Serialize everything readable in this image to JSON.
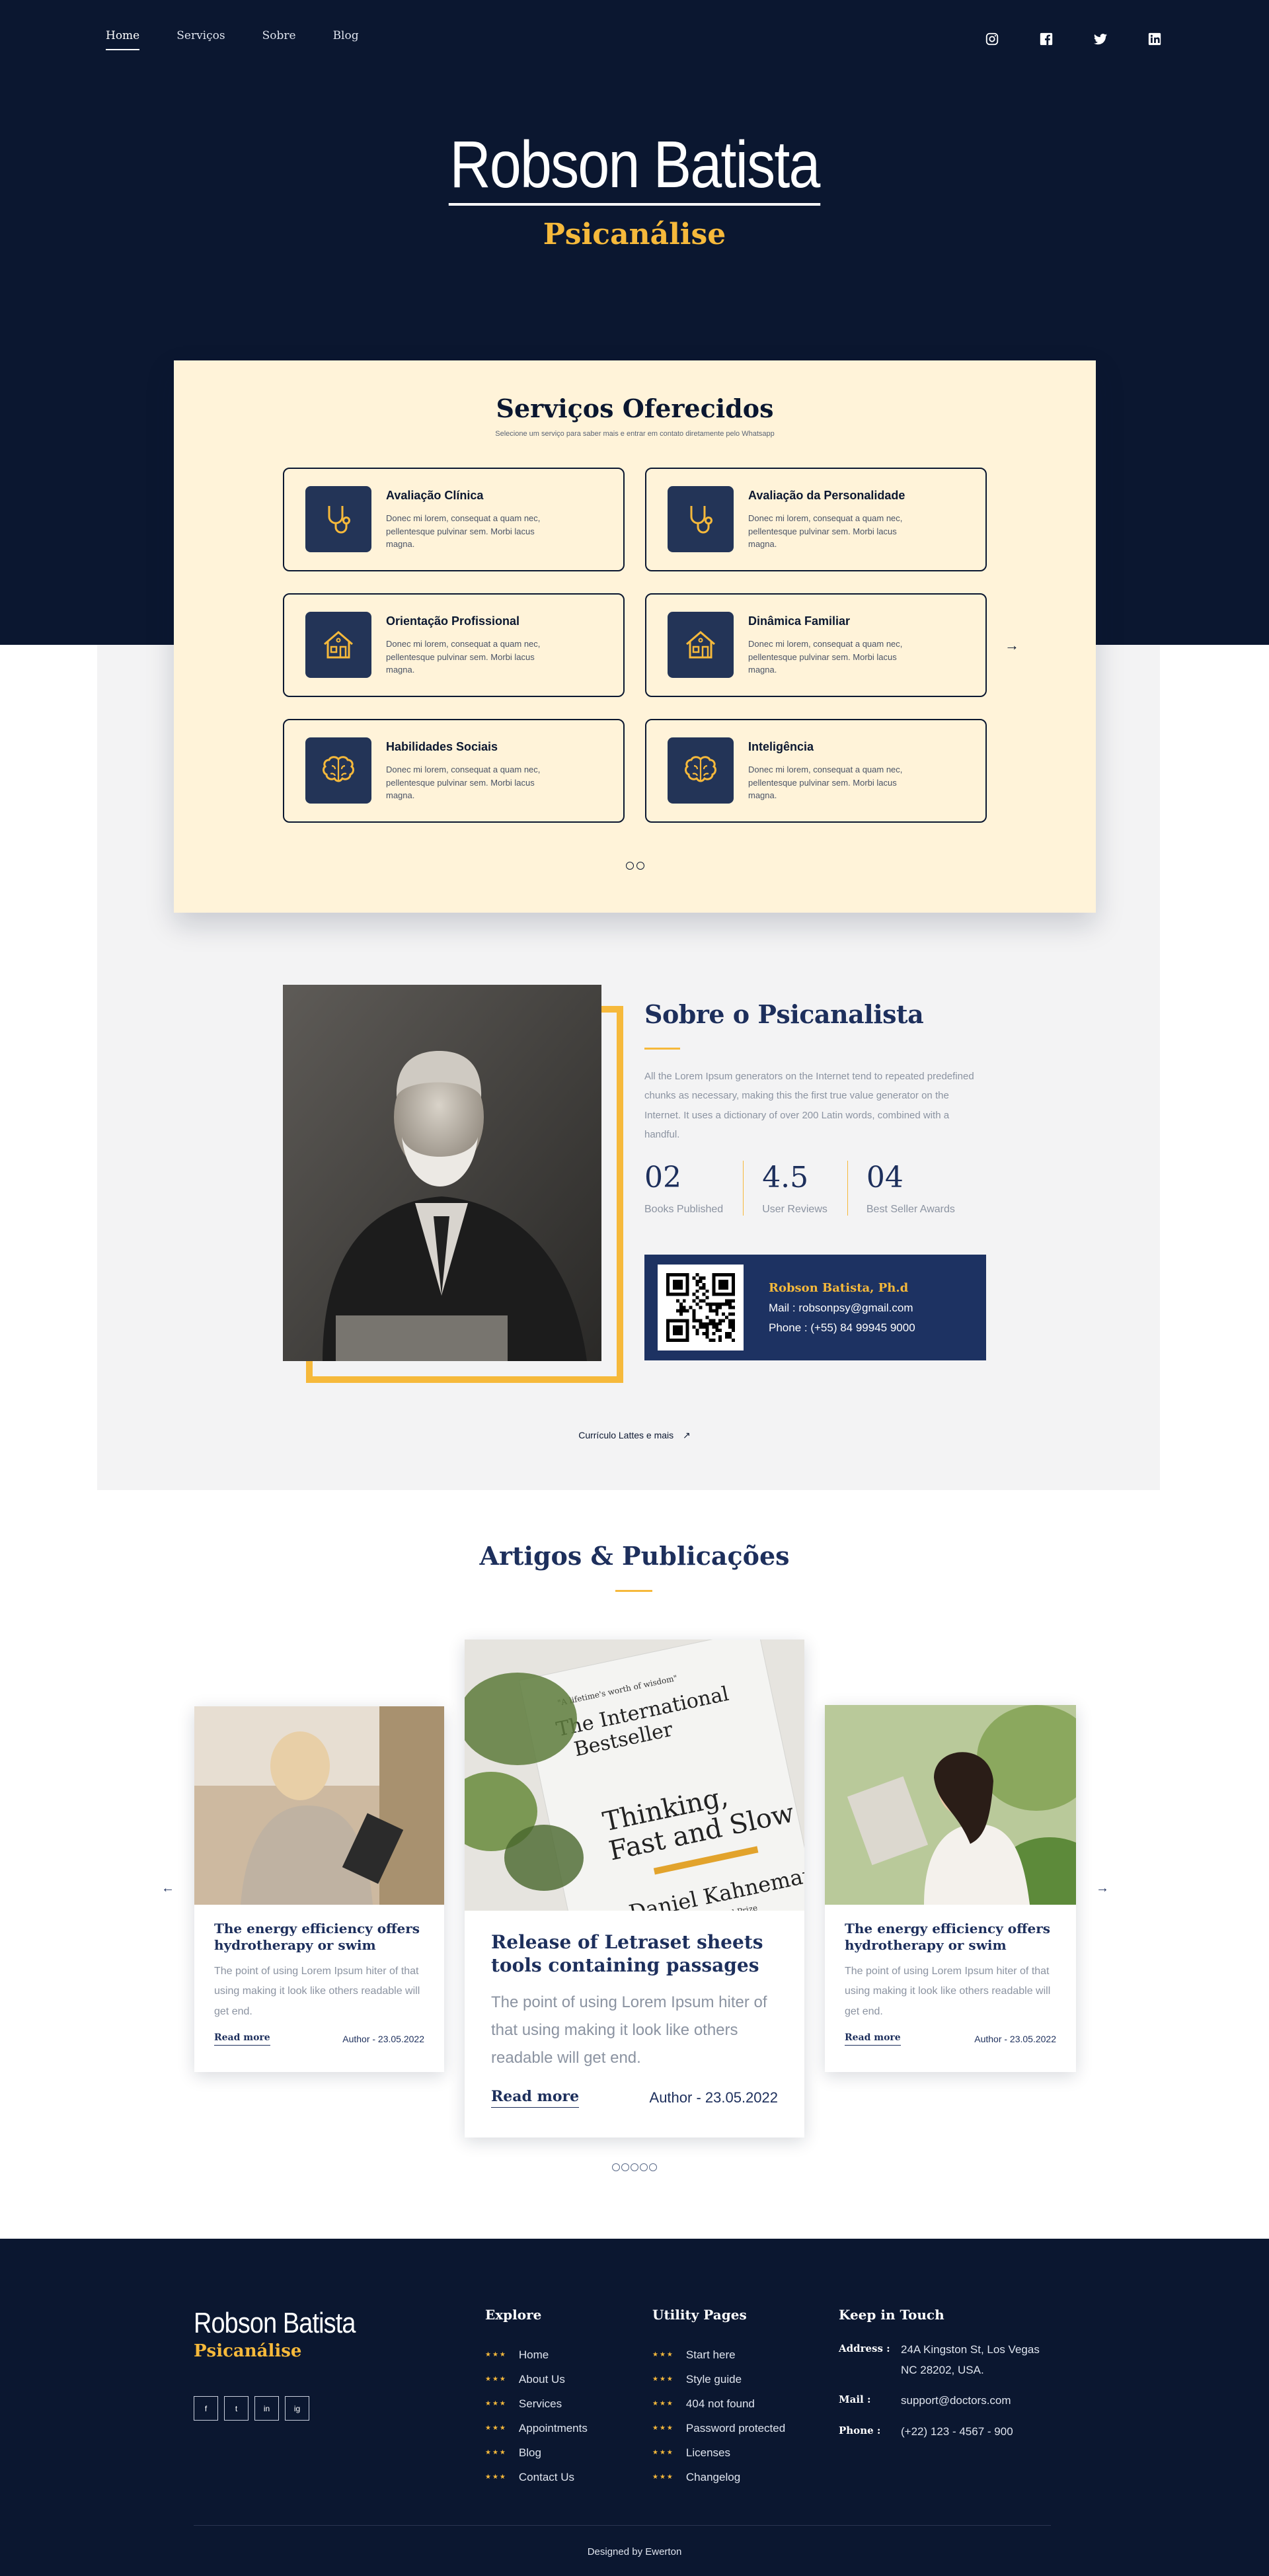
{
  "nav": {
    "items": [
      {
        "label": "Home",
        "active": true
      },
      {
        "label": "Serviços",
        "active": false
      },
      {
        "label": "Sobre",
        "active": false
      },
      {
        "label": "Blog",
        "active": false
      }
    ],
    "socials": [
      "instagram-icon",
      "facebook-icon",
      "twitter-icon",
      "linkedin-icon"
    ]
  },
  "hero": {
    "title": "Robson Batista",
    "subtitle": "Psicanálise"
  },
  "services": {
    "heading": "Serviços Oferecidos",
    "subheading": "Selecione um serviço para saber mais e entrar em contato diretamente pelo Whatsapp",
    "items": [
      {
        "title": "Avaliação Clínica",
        "text": "Donec mi lorem, consequat a quam nec, pellentesque pulvinar sem. Morbi lacus magna.",
        "icon": "stethoscope-icon"
      },
      {
        "title": "Avaliação da Personalidade",
        "text": "Donec mi lorem, consequat a quam nec, pellentesque pulvinar sem. Morbi lacus magna.",
        "icon": "stethoscope-icon"
      },
      {
        "title": "Orientação Profissional",
        "text": "Donec mi lorem, consequat a quam nec, pellentesque pulvinar sem. Morbi lacus magna.",
        "icon": "house-icon"
      },
      {
        "title": "Dinâmica Familiar",
        "text": "Donec mi lorem, consequat a quam nec, pellentesque pulvinar sem. Morbi lacus magna.",
        "icon": "house-icon"
      },
      {
        "title": "Habilidades Sociais",
        "text": "Donec mi lorem, consequat a quam nec, pellentesque pulvinar sem. Morbi lacus magna.",
        "icon": "brain-icon"
      },
      {
        "title": "Inteligência",
        "text": "Donec mi lorem, consequat a quam nec, pellentesque pulvinar sem. Morbi lacus magna.",
        "icon": "brain-icon"
      }
    ]
  },
  "about": {
    "heading": "Sobre o Psicanalista",
    "paragraph": "All the Lorem Ipsum generators on the Internet tend to repeated predefined chunks as necessary, making this the first true value generator on the Internet. It uses a dictionary of over 200 Latin words, combined with a handful.",
    "stats": [
      {
        "value": "02",
        "label": "Books Published"
      },
      {
        "value": "4.5",
        "label": "User Reviews"
      },
      {
        "value": "04",
        "label": "Best Seller Awards"
      }
    ],
    "card": {
      "name": "Robson Batista, Ph.d",
      "mail": "Mail : robsonpsy@gmail.com",
      "phone": "Phone : (+55) 84 99945 9000"
    },
    "link": "Currículo Lattes e mais"
  },
  "articles": {
    "heading": "Artigos & Publicações",
    "items": [
      {
        "title": "The energy efficiency offers hydrotherapy or swim",
        "text": "The point of using Lorem Ipsum hiter of that using making it look like others readable will get end.",
        "more": "Read more",
        "author": "Author - 23.05.2022"
      },
      {
        "title": "Release of Letraset sheets tools containing  passages",
        "text": "The point of using Lorem Ipsum hiter of that using making it look like others readable will get end.",
        "more": "Read more",
        "author": "Author - 23.05.2022",
        "book_lines": [
          "\"A lifetime's worth of wisdom\"",
          "The International",
          "Bestseller",
          "Thinking,",
          "Fast and Slow",
          "Daniel Kahneman",
          "Nobel Prize"
        ]
      },
      {
        "title": "The energy efficiency offers hydrotherapy or swim",
        "text": "The point of using Lorem Ipsum hiter of that using making it look like others readable will get end.",
        "more": "Read more",
        "author": "Author - 23.05.2022"
      }
    ]
  },
  "footer": {
    "brand_title": "Robson Batista",
    "brand_subtitle": "Psicanálise",
    "social_labels": [
      "f",
      "t",
      "in",
      "ig"
    ],
    "explore": {
      "heading": "Explore",
      "items": [
        "Home",
        "About Us",
        "Services",
        "Appointments",
        "Blog",
        "Contact Us"
      ]
    },
    "utility": {
      "heading": "Utility Pages",
      "items": [
        "Start here",
        "Style guide",
        "404 not found",
        "Password protected",
        "Licenses",
        "Changelog"
      ]
    },
    "contact": {
      "heading": "Keep in Touch",
      "address_label": "Address :",
      "address": "24A Kingston St, Los Vegas NC 28202, USA.",
      "mail_label": "Mail :",
      "mail": "support@doctors.com",
      "phone_label": "Phone :",
      "phone": "(+22) 123 - 4567 - 900"
    },
    "credit": "Designed by Ewerton"
  }
}
